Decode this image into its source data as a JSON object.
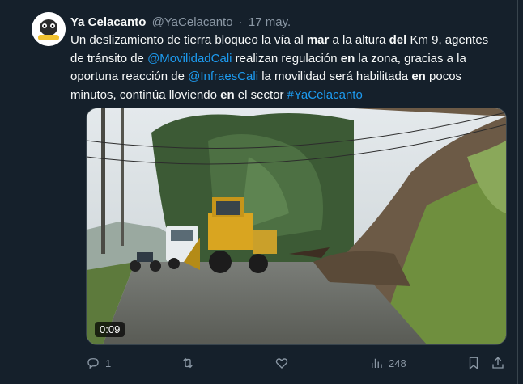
{
  "tweet": {
    "author_name": "Ya Celacanto",
    "author_handle": "@YaCelacanto",
    "separator": "·",
    "date": "17 may.",
    "avatar_text": "Ya Celacanto",
    "text": [
      {
        "t": "Un deslizamiento de tierra bloqueo la vía al ",
        "style": "normal"
      },
      {
        "t": "mar",
        "style": "bold"
      },
      {
        "t": " a la altura ",
        "style": "normal"
      },
      {
        "t": "del",
        "style": "bold"
      },
      {
        "t": " Km 9, agentes de tránsito de ",
        "style": "normal"
      },
      {
        "t": "@MovilidadCali",
        "style": "link"
      },
      {
        "t": " realizan regulación ",
        "style": "normal"
      },
      {
        "t": "en",
        "style": "bold"
      },
      {
        "t": " la zona, gracias a la oportuna reacción de ",
        "style": "normal"
      },
      {
        "t": "@InfraesCali",
        "style": "link"
      },
      {
        "t": " la movilidad será habilitada ",
        "style": "normal"
      },
      {
        "t": "en",
        "style": "bold"
      },
      {
        "t": " pocos minutos, continúa lloviendo ",
        "style": "normal"
      },
      {
        "t": "en",
        "style": "bold"
      },
      {
        "t": " el sector ",
        "style": "normal"
      },
      {
        "t": "#YaCelacanto",
        "style": "link"
      }
    ],
    "video_duration": "0:09"
  },
  "actions": {
    "reply_count": "1",
    "retweet_count": "",
    "like_count": "",
    "views_count": "248"
  },
  "colors": {
    "background": "#15202b",
    "text": "#f7f9f9",
    "secondary": "#8b98a5",
    "link": "#1d9bf0"
  },
  "icons": [
    "reply-icon",
    "retweet-icon",
    "like-icon",
    "views-icon",
    "bookmark-icon",
    "share-icon"
  ]
}
